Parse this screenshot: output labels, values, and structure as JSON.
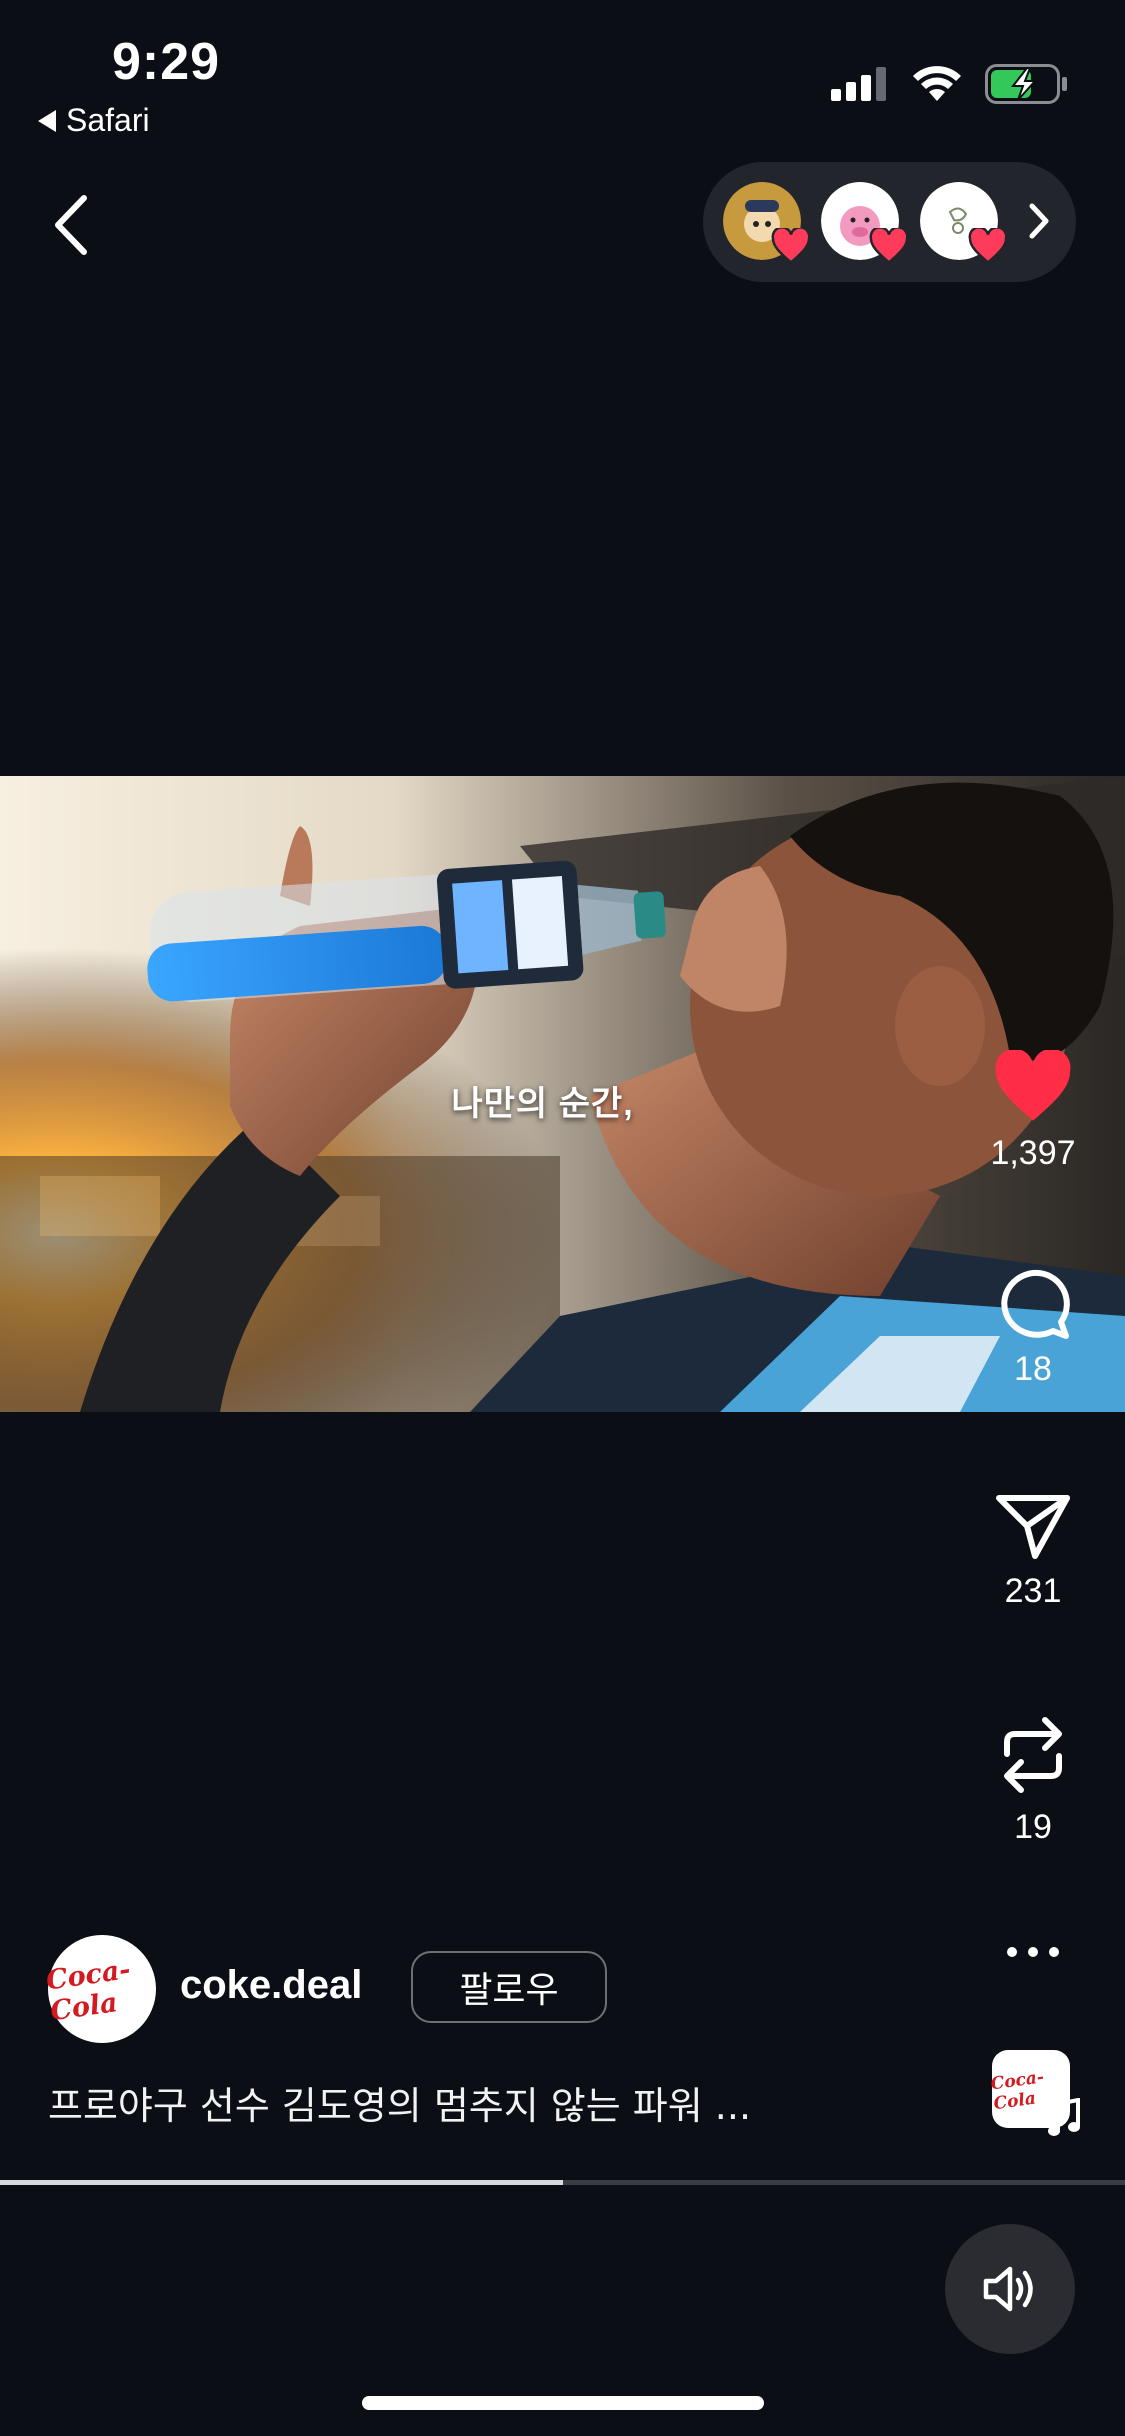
{
  "status_bar": {
    "time": "9:29",
    "back_app": "Safari"
  },
  "icons": {
    "back": "chevron-left-icon",
    "like": "heart-icon",
    "comment": "comment-bubble-icon",
    "share": "send-icon",
    "repost": "repost-icon",
    "more": "ellipsis-icon",
    "sound": "speaker-icon",
    "music": "music-note-icon"
  },
  "colors": {
    "background": "#0b0e14",
    "like_red": "#ff2d45",
    "coke_red": "#d31a21"
  },
  "video": {
    "subtitle": "나만의 순간,"
  },
  "actions": {
    "likes": "1,397",
    "comments": "18",
    "shares": "231",
    "reposts": "19"
  },
  "post": {
    "username": "coke.deal",
    "follow_label": "팔로우",
    "caption": "프로야구 선수 김도영의 멈추지 않는 파워 ...",
    "logo_text": "Coca-Cola"
  },
  "playback": {
    "progress": 0.5
  }
}
